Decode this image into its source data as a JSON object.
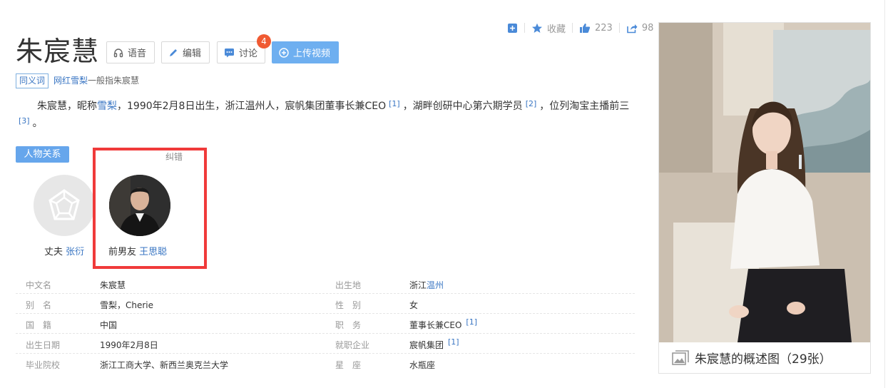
{
  "title": "朱宸慧",
  "toolbar": {
    "voice_label": "语音",
    "edit_label": "编辑",
    "discuss_label": "讨论",
    "discuss_badge": "4",
    "upload_label": "上传视频"
  },
  "actions": {
    "collect_label": "收藏",
    "like_count": "223",
    "share_count": "98"
  },
  "synonym": {
    "tag": "同义词",
    "term": "网红雪梨",
    "rest": "一般指朱宸慧"
  },
  "summary": {
    "t1": "朱宸慧，昵称",
    "link1": "雪梨",
    "t2": "，1990年2月8日出生，浙江温州人，宸帆集团董事长兼CEO",
    "ref1": "[1]",
    "t3": "，湖畔创研中心第六期学员",
    "ref2": "[2]",
    "t4": "，位列淘宝主播前三",
    "ref3": "[3]",
    "t5": "。"
  },
  "relations": {
    "tag": "人物关系",
    "correct_label": "纠错",
    "items": [
      {
        "relation": "丈夫",
        "name": "张衍"
      },
      {
        "relation": "前男友",
        "name": "王思聪"
      }
    ]
  },
  "info": {
    "rows": [
      {
        "k1": "中文名",
        "v1": "朱宸慧",
        "k2": "出生地",
        "v2a": "浙江",
        "v2b": "温州"
      },
      {
        "k1": "别　名",
        "v1": "雪梨，Cherie",
        "k2": "性　别",
        "v2a": "女",
        "v2b": ""
      },
      {
        "k1": "国　籍",
        "v1": "中国",
        "k2": "职　务",
        "v2a": "董事长兼CEO",
        "ref": "[1]"
      },
      {
        "k1": "出生日期",
        "v1": "1990年2月8日",
        "k2": "就职企业",
        "v2a": "宸帆集团",
        "ref": "[1]"
      },
      {
        "k1": "毕业院校",
        "v1": "浙江工商大学、新西兰奥克兰大学",
        "k2": "星　座",
        "v2a": "水瓶座",
        "v2b": ""
      }
    ]
  },
  "album": {
    "caption": "朱宸慧的概述图（29张）"
  },
  "icons": {
    "voice": "headphones-icon",
    "edit": "pencil-icon",
    "discuss": "chat-icon",
    "upload": "plus-circle-icon",
    "add": "add-box-icon",
    "collect": "star-icon",
    "like": "thumbs-up-icon",
    "share": "share-icon",
    "album": "image-icon"
  },
  "colors": {
    "link": "#3a76c3",
    "accent": "#66a6ec",
    "badge": "#f05a32",
    "highlight": "#f03a3a"
  }
}
